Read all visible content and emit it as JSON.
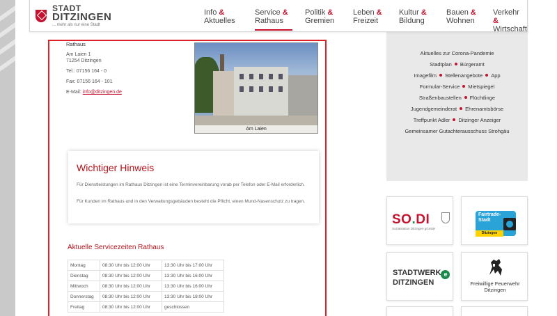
{
  "header": {
    "logo_line1": "STADT",
    "logo_line2": "DITZINGEN",
    "logo_tagline": "... mehr als nur eine Stadt",
    "nav": [
      {
        "a": "Info",
        "b": "Aktuelles",
        "active": false
      },
      {
        "a": "Service",
        "b": "Rathaus",
        "active": true
      },
      {
        "a": "Politik",
        "b": "Gremien",
        "active": false
      },
      {
        "a": "Leben",
        "b": "Freizeit",
        "active": false
      },
      {
        "a": "Kultur",
        "b": "Bildung",
        "active": false
      },
      {
        "a": "Bauen",
        "b": "Wohnen",
        "active": false
      },
      {
        "a": "Verkehr",
        "b": "Wirtschaft",
        "active": false
      }
    ],
    "amp": "&"
  },
  "address": {
    "heading": "Rathaus",
    "street": "Am Laien 1",
    "city": "71254 Ditzingen",
    "phone": "Tel.: 07156 164 - 0",
    "fax": "Fax: 07156 164 - 101",
    "email_label": "E-Mail:",
    "email": "info@ditzingen.de"
  },
  "photo": {
    "caption": "Am Laien"
  },
  "notice": {
    "title": "Wichtiger Hinweis",
    "p1": "Für Dienstleistungen im Rathaus Ditzingen ist eine Terminvereinbarung vorab per Telefon oder E-Mail erforderlich.",
    "p2": "Für Kunden im Rathaus und in den Verwaltungsgebäuden besteht die Pflicht, einen Mund-Nasenschutz zu tragen."
  },
  "service": {
    "title": "Aktuelle Servicezeiten Rathaus",
    "rows": [
      {
        "day": "Montag",
        "t1": "08:30 Uhr bis 12:00 Uhr",
        "t2": "13:30 Uhr bis 17:00 Uhr"
      },
      {
        "day": "Dienstag",
        "t1": "08:30 Uhr bis 12:00 Uhr",
        "t2": "13:30 Uhr bis 16:00 Uhr"
      },
      {
        "day": "Mittwoch",
        "t1": "08:30 Uhr bis 12:00 Uhr",
        "t2": "13:30 Uhr bis 16:00 Uhr"
      },
      {
        "day": "Donnerstag",
        "t1": "08:30 Uhr bis 12:00 Uhr",
        "t2": "13:30 Uhr bis 18:00 Uhr"
      },
      {
        "day": "Freitag",
        "t1": "08:30 Uhr bis 12:00 Uhr",
        "t2": "geschlossen"
      }
    ]
  },
  "sidebar": {
    "links": [
      [
        "Aktuelles zur Corona-Pandemie"
      ],
      [
        "Stadtplan",
        "Bürgeramt"
      ],
      [
        "Imagefilm",
        "Stellenangebote",
        "App"
      ],
      [
        "Formular-Service",
        "Mietspiegel"
      ],
      [
        "Straßenbaustellen",
        "Flüchtlinge"
      ],
      [
        "Jugendgemeinderat",
        "Ehrenamtsbörse"
      ],
      [
        "Treffpunkt Adler",
        "Ditzinger Anzeiger"
      ],
      [
        "Gemeinsamer Gutachterausschuss Strohgäu"
      ]
    ],
    "sodi_main": "SO",
    "sodi_dot": ".",
    "sodi_end": "DI",
    "sodi_sub": "Sozialstation Ditzingen gGmbH",
    "fairtrade_line1": "Fairtrade-",
    "fairtrade_line2": "Stadt",
    "fairtrade_city": "Ditzingen",
    "stadtwerke_line1": "STADTWERK",
    "stadtwerke_e": "e",
    "stadtwerke_line2": "DITZINGEN",
    "feuerwehr": "Freiwillige Feuerwehr Ditzingen"
  },
  "colors": {
    "accent": "#c4122f",
    "outline": "#e02027",
    "sidebar_bg": "#e9e9e9"
  }
}
